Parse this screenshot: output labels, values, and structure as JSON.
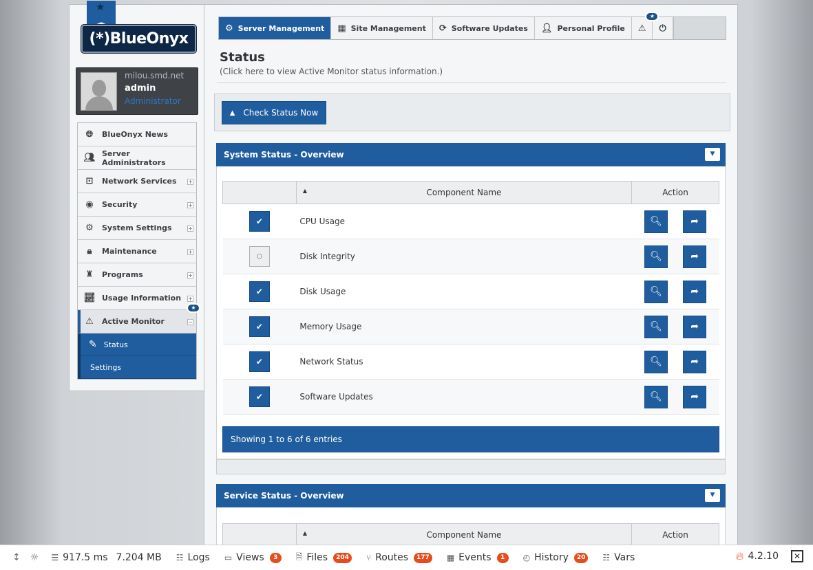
{
  "brand": {
    "logo_text": "(*)BlueOnyx"
  },
  "user": {
    "host": "milou.smd.net",
    "name": "admin",
    "role": "Administrator"
  },
  "sidebar": {
    "items": [
      {
        "label": "BlueOnyx News",
        "icon": "globe-icon",
        "expandable": false
      },
      {
        "label": "Server Administrators",
        "icon": "users-icon",
        "expandable": false
      },
      {
        "label": "Network Services",
        "icon": "network-icon",
        "expandable": true
      },
      {
        "label": "Security",
        "icon": "eye-icon",
        "expandable": true
      },
      {
        "label": "System Settings",
        "icon": "gear-icon",
        "expandable": true
      },
      {
        "label": "Maintenance",
        "icon": "lock-icon",
        "expandable": true
      },
      {
        "label": "Programs",
        "icon": "robot-icon",
        "expandable": true
      },
      {
        "label": "Usage Information",
        "icon": "chart-icon",
        "expandable": true
      },
      {
        "label": "Active Monitor",
        "icon": "warning-icon",
        "expandable": true
      }
    ],
    "subitems": [
      {
        "label": "Status"
      },
      {
        "label": "Settings"
      }
    ],
    "expand_symbol": "+",
    "collapse_symbol": "−"
  },
  "tabs": [
    {
      "label": "Server Management",
      "icon": "gear-icon"
    },
    {
      "label": "Site Management",
      "icon": "layout-icon"
    },
    {
      "label": "Software Updates",
      "icon": "refresh-icon"
    },
    {
      "label": "Personal Profile",
      "icon": "user-icon"
    }
  ],
  "page": {
    "title": "Status",
    "subtitle": "(Click here to view Active Monitor status information.)",
    "check_button": "Check Status Now"
  },
  "system_panel": {
    "title": "System Status - Overview",
    "columns": {
      "component": "Component Name",
      "action": "Action"
    },
    "rows": [
      {
        "name": "CPU Usage",
        "checked": true
      },
      {
        "name": "Disk Integrity",
        "checked": false
      },
      {
        "name": "Disk Usage",
        "checked": true
      },
      {
        "name": "Memory Usage",
        "checked": true
      },
      {
        "name": "Network Status",
        "checked": true
      },
      {
        "name": "Software Updates",
        "checked": true
      }
    ],
    "footer": "Showing 1 to 6 of 6 entries"
  },
  "service_panel": {
    "title": "Service Status - Overview",
    "columns": {
      "component": "Component Name",
      "action": "Action"
    }
  },
  "debugbar": {
    "time": "917.5 ms",
    "memory": "7.204 MB",
    "items": [
      {
        "label": "Logs",
        "count": null
      },
      {
        "label": "Views",
        "count": "3"
      },
      {
        "label": "Files",
        "count": "204"
      },
      {
        "label": "Routes",
        "count": "177"
      },
      {
        "label": "Events",
        "count": "1"
      },
      {
        "label": "History",
        "count": "20"
      },
      {
        "label": "Vars",
        "count": null
      }
    ],
    "version": "4.2.10"
  },
  "colors": {
    "primary": "#1f5d9e",
    "badge": "#e74c1d"
  }
}
